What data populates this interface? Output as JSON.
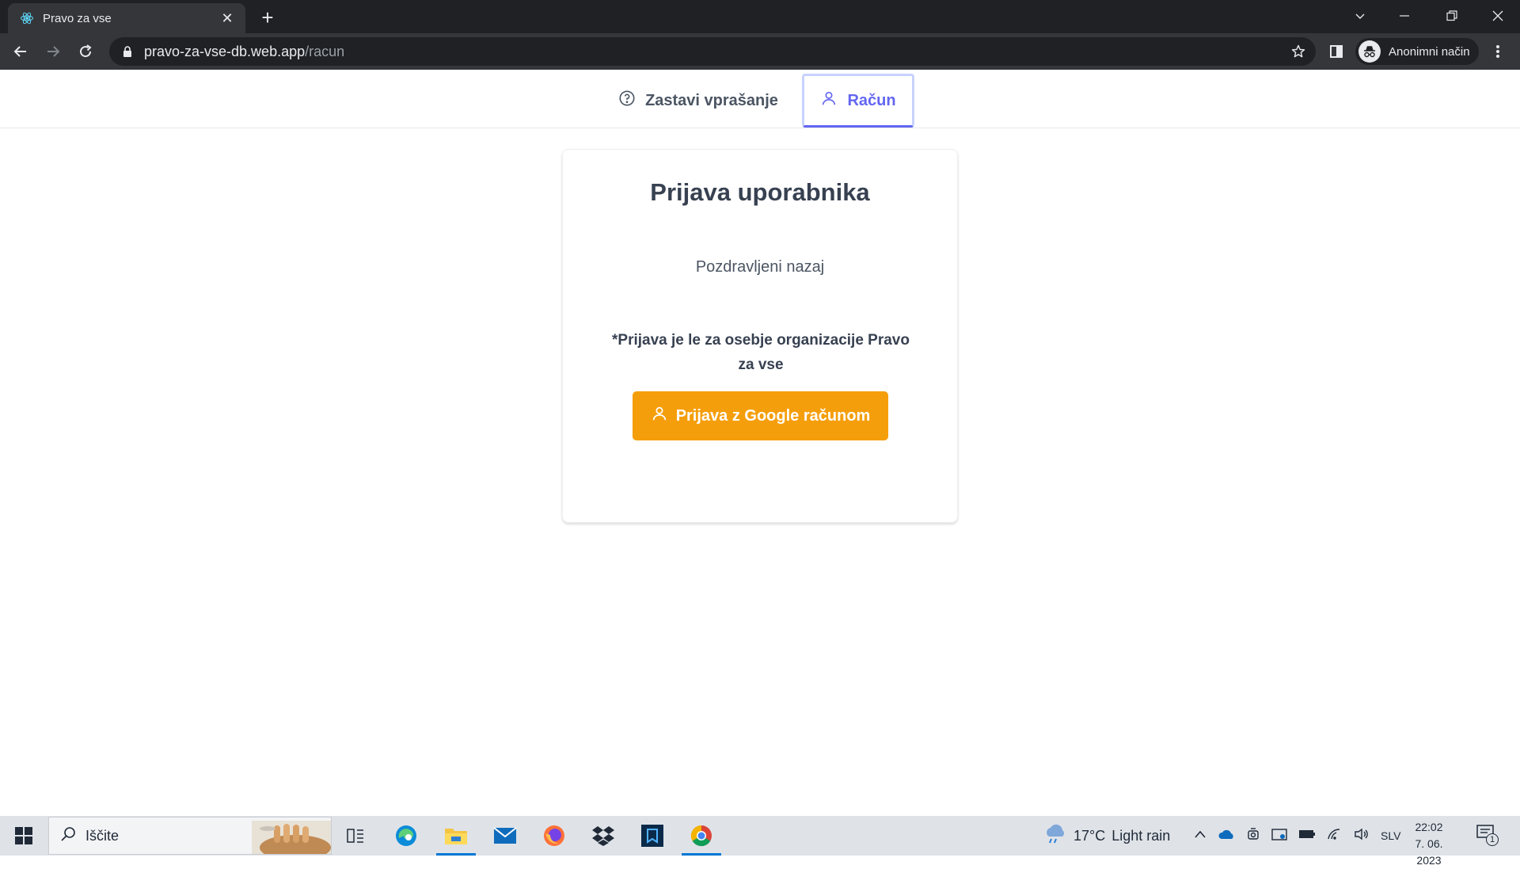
{
  "browser": {
    "tab_title": "Pravo za vse",
    "url_host": "pravo-za-vse-db.web.app",
    "url_path": "/racun",
    "profile_label": "Anonimni način"
  },
  "nav": {
    "ask_label": "Zastavi vprašanje",
    "account_label": "Račun"
  },
  "login": {
    "title": "Prijava uporabnika",
    "welcome": "Pozdravljeni nazaj",
    "note": "*Prijava je le za osebje organizacije Pravo za vse",
    "button_label": "Prijava z Google računom"
  },
  "taskbar": {
    "search_placeholder": "Iščite",
    "weather_temp": "17°C",
    "weather_desc": "Light rain",
    "language": "SLV",
    "time": "22:02",
    "date": "7. 06. 2023",
    "notification_count": "1"
  },
  "colors": {
    "accent": "#6366f1",
    "button": "#f59e0b",
    "chrome_dark": "#202124",
    "chrome_mid": "#35363a"
  }
}
